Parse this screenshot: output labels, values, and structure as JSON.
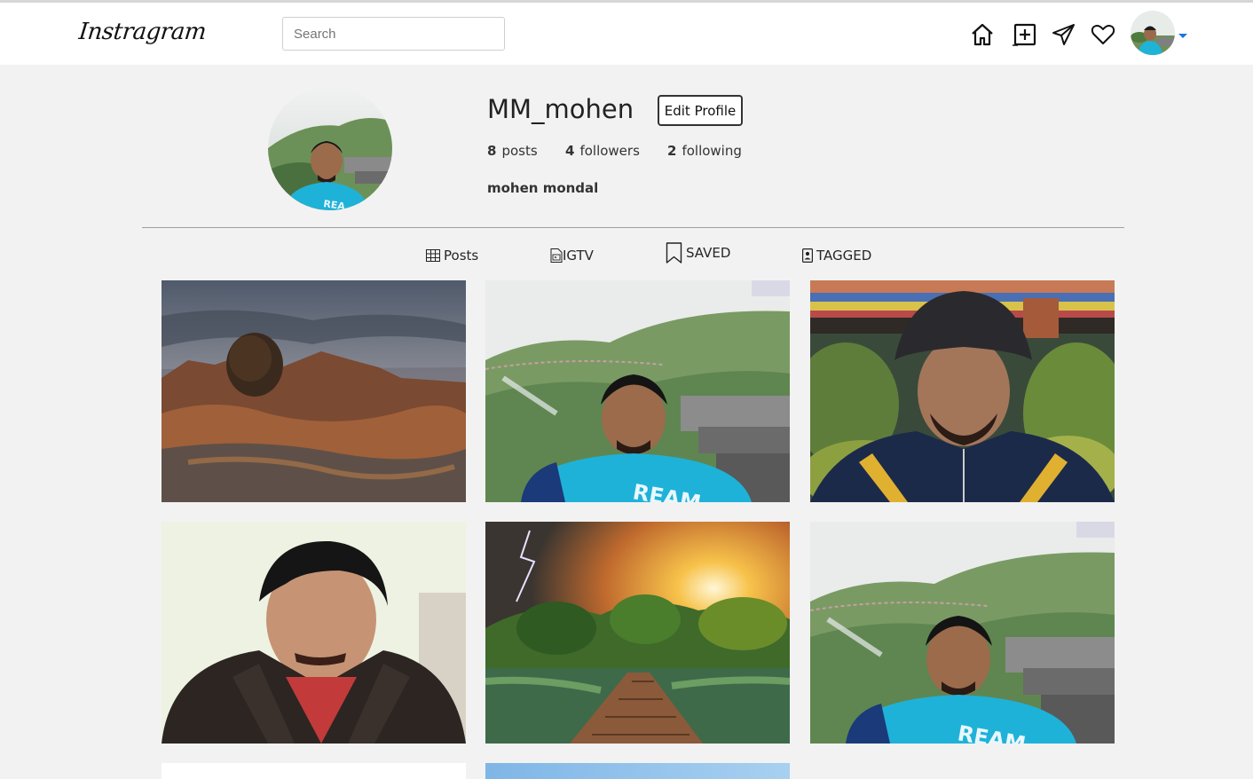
{
  "navbar": {
    "logo": "Instragram",
    "search_placeholder": "Search",
    "icons": [
      "home-icon",
      "new-post-icon",
      "direct-message-icon",
      "heart-icon"
    ],
    "accent_color": "#1a73e8"
  },
  "profile": {
    "username": "MM_mohen",
    "edit_label": "Edit Profile",
    "posts_count": "8",
    "posts_label": "posts",
    "followers_count": "4",
    "followers_label": "followers",
    "following_count": "2",
    "following_label": "following",
    "full_name": "mohen mondal"
  },
  "tabs": [
    {
      "label": "Posts",
      "icon": "grid-icon"
    },
    {
      "label": "IGTV",
      "icon": "igtv-icon"
    },
    {
      "label": "SAVED",
      "icon": "bookmark-icon"
    },
    {
      "label": "TAGGED",
      "icon": "tagged-icon"
    }
  ],
  "posts": [
    {
      "subject": "desert landscape at dusk"
    },
    {
      "subject": "selfie on mountain rocks"
    },
    {
      "subject": "selfie in beanie with prayer flags"
    },
    {
      "subject": "selfie in leather jacket"
    },
    {
      "subject": "wooden bridge with sunset and lightning"
    },
    {
      "subject": "selfie on mountain rocks"
    },
    {
      "subject": "partial post"
    },
    {
      "subject": "partial post"
    }
  ]
}
